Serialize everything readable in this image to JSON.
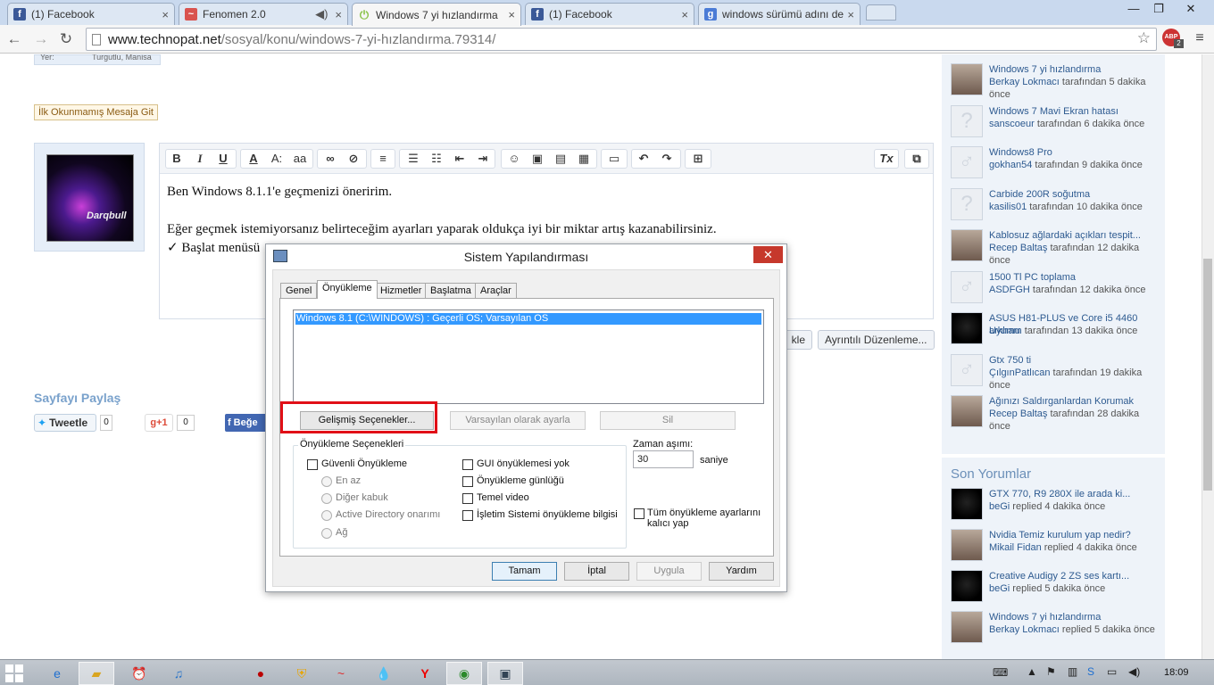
{
  "browser": {
    "tabs": [
      {
        "title": "(1) Facebook",
        "icon": "facebook-icon",
        "color": "#3b5998",
        "glyph": "f"
      },
      {
        "title": "Fenomen 2.0",
        "icon": "fenomen-icon",
        "color": "#d9534f",
        "glyph": "~"
      },
      {
        "title": "Windows 7 yi hızlandırma",
        "icon": "technopat-power-icon",
        "color": "#8bc34a",
        "glyph": "⏻"
      },
      {
        "title": "(1) Facebook",
        "icon": "facebook-icon",
        "color": "#3b5998",
        "glyph": "f"
      },
      {
        "title": "windows sürümü adını de",
        "icon": "google-icon",
        "color": "#4a7bd6",
        "glyph": "g"
      }
    ],
    "url_host": "www.technopat.net",
    "url_path": "/sosyal/konu/windows-7-yi-hızlandırma.79314/",
    "abp_badge": "ABP",
    "abp_count": "2"
  },
  "post": {
    "yer_label": "Yer:",
    "yer_value": "Turgutlu, Manisa",
    "unread_button": "İlk Okunmamış Mesaja Git",
    "avatar_name": "Darqbull",
    "editor_line1": "Ben Windows 8.1.1'e geçmenizi öneririm.",
    "editor_line2": "Eğer geçmek istemiyorsanız belirteceğim ayarları yaparak oldukça iyi bir miktar artış kazanabilirsiniz.",
    "editor_line3": "✓ Başlat menüsü",
    "btn_partial": "kle",
    "btn_advanced": "Ayrıntılı Düzenleme...",
    "share_heading": "Sayfayı Paylaş",
    "tweet_label": "Tweetle",
    "tweet_count": "0",
    "gplus_label": "g+1",
    "gplus_count": "0",
    "fb_label": "Beğe"
  },
  "sidebar": {
    "threads": [
      {
        "title": "Windows 7 yi hızlandırma",
        "user": "Berkay Lokmacı",
        "meta": " tarafından 5 dakika önce",
        "avatar": "photo"
      },
      {
        "title": "Windows 7 Mavi Ekran hatası",
        "user": "sanscoeur",
        "meta": " tarafından 6 dakika önce",
        "avatar": "unknown"
      },
      {
        "title": "Windows8 Pro",
        "user": "gokhan54",
        "meta": " tarafından 9 dakika önce",
        "avatar": "male"
      },
      {
        "title": "Carbide 200R soğutma",
        "user": "kasilis01",
        "meta": " tarafından 10 dakika önce",
        "avatar": "unknown"
      },
      {
        "title": "Kablosuz ağlardaki açıkları tespit...",
        "user": "Recep Baltaş",
        "meta": " tarafından 12 dakika önce",
        "avatar": "photo"
      },
      {
        "title": "1500 Tl PC toplama",
        "user": "ASDFGH",
        "meta": " tarafından 12 dakika önce",
        "avatar": "male"
      },
      {
        "title": "ASUS H81-PLUS ve Core i5 4460 Uyumu",
        "user": "arkham",
        "meta": " tarafından 13 dakika önce",
        "avatar": "dark"
      },
      {
        "title": "Gtx 750 ti",
        "user": "ÇılgınPatlıcan",
        "meta": " tarafından 19 dakika önce",
        "avatar": "male"
      },
      {
        "title": "Ağınızı Saldırganlardan Korumak",
        "user": "Recep Baltaş",
        "meta": " tarafından 28 dakika önce",
        "avatar": "photo"
      }
    ],
    "comments_heading": "Son Yorumlar",
    "comments": [
      {
        "title": "GTX 770, R9 280X ile arada ki...",
        "user": "beGi",
        "meta": " replied 4 dakika önce",
        "avatar": "dark"
      },
      {
        "title": "Nvidia Temiz kurulum yap nedir?",
        "user": "Mikail Fidan",
        "meta": " replied 4 dakika önce",
        "avatar": "photo"
      },
      {
        "title": "Creative Audigy 2 ZS ses kartı...",
        "user": "beGi",
        "meta": " replied 5 dakika önce",
        "avatar": "dark"
      },
      {
        "title": "Windows 7 yi hızlandırma",
        "user": "Berkay Lokmacı",
        "meta": " replied 5 dakika önce",
        "avatar": "photo"
      }
    ]
  },
  "dialog": {
    "title": "Sistem Yapılandırması",
    "close": "✕",
    "tabs": [
      "Genel",
      "Önyükleme",
      "Hizmetler",
      "Başlatma",
      "Araçlar"
    ],
    "active_tab": "Önyükleme",
    "os_entry": "Windows 8.1 (C:\\WINDOWS) : Geçerli OS; Varsayılan OS",
    "btn_advanced": "Gelişmiş Seçenekler...",
    "btn_default": "Varsayılan olarak ayarla",
    "btn_delete": "Sil",
    "group_title": "Önyükleme Seçenekleri",
    "safe_boot": "Güvenli Önyükleme",
    "radio_minimal": "En az",
    "radio_shell": "Diğer kabuk",
    "radio_ad": "Active Directory onarımı",
    "radio_network": "Ağ",
    "no_gui": "GUI önyüklemesi yok",
    "boot_log": "Önyükleme günlüğü",
    "base_video": "Temel video",
    "os_info": "İşletim Sistemi önyükleme bilgisi",
    "timeout_label": "Zaman aşımı:",
    "timeout_value": "30",
    "seconds": "saniye",
    "persist_1": "Tüm önyükleme ayarlarını",
    "persist_2": "kalıcı yap",
    "ok": "Tamam",
    "cancel": "İptal",
    "apply": "Uygula",
    "help": "Yardım"
  },
  "taskbar": {
    "clock": "18:09",
    "apps": [
      "ie-icon",
      "explorer-icon",
      "alarm-icon",
      "itunes-icon",
      "media-icon",
      "shield-app-icon",
      "fenomen-icon",
      "drop-icon",
      "yandex-icon",
      "chrome-icon",
      "msconfig-icon"
    ]
  }
}
